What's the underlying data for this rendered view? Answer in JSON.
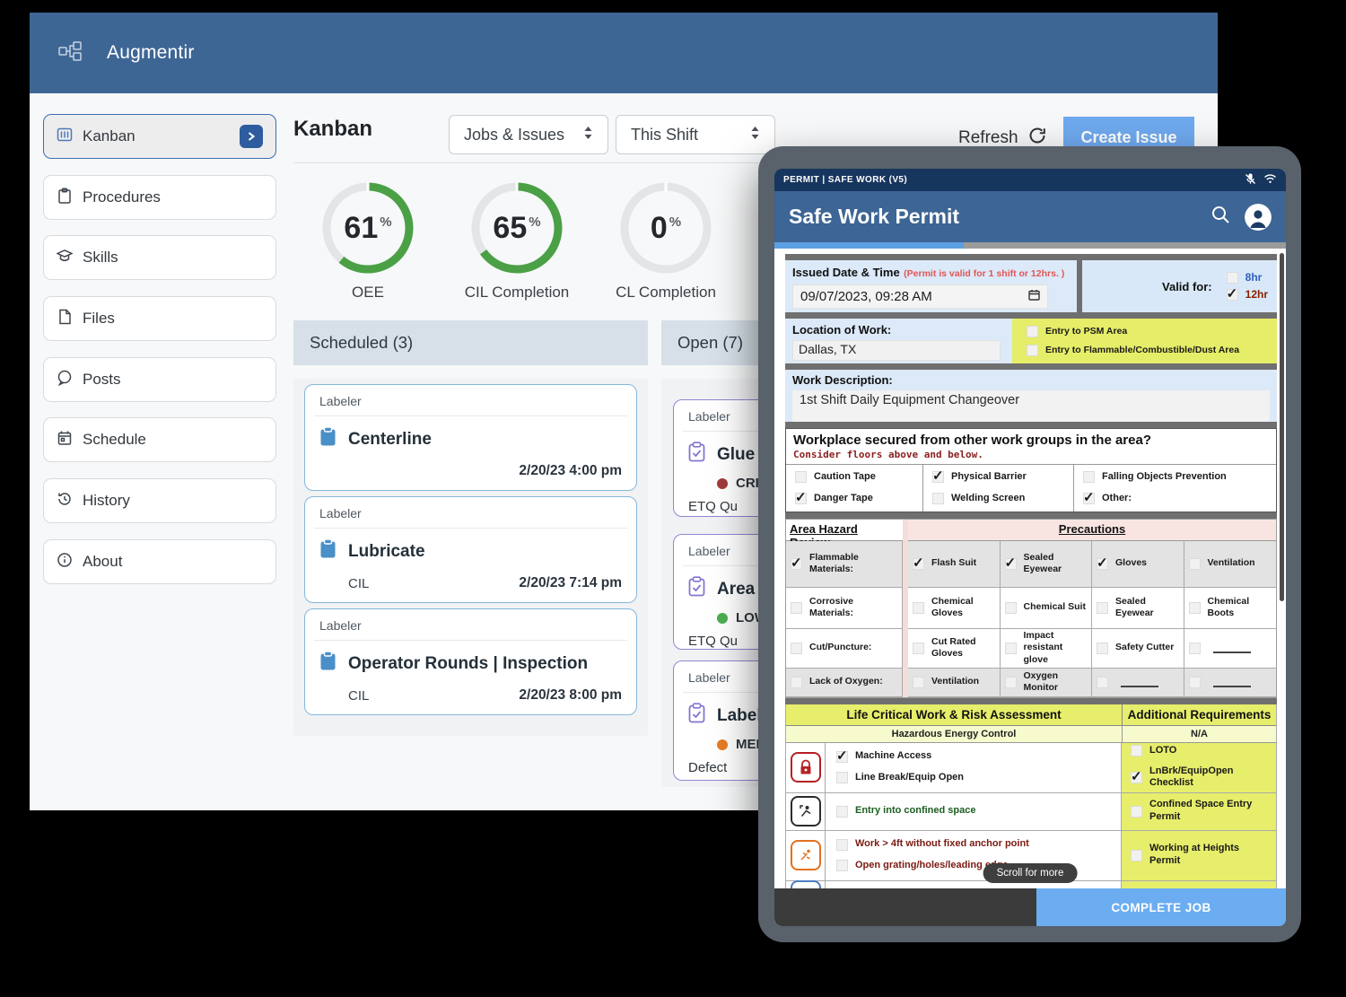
{
  "app": {
    "brand": "Augmentir",
    "title": "Kanban",
    "filters": {
      "scope": "Jobs & Issues",
      "range": "This Shift"
    },
    "actions": {
      "refresh": "Refresh",
      "create_issue": "Create Issue"
    },
    "sidebar": {
      "items": [
        {
          "label": "Kanban",
          "selected": true
        },
        {
          "label": "Procedures"
        },
        {
          "label": "Skills"
        },
        {
          "label": "Files"
        },
        {
          "label": "Posts"
        },
        {
          "label": "Schedule"
        },
        {
          "label": "History"
        },
        {
          "label": "About"
        }
      ]
    },
    "metrics": [
      {
        "value": 61,
        "unit": "%",
        "label": "OEE",
        "color": "#4ba046"
      },
      {
        "value": 65,
        "unit": "%",
        "label": "CIL Completion",
        "color": "#4ba046"
      },
      {
        "value": 0,
        "unit": "%",
        "label": "CL Completion",
        "color": "#4ba046"
      }
    ],
    "board": {
      "columns": [
        {
          "title": "Scheduled (3)",
          "cards": [
            {
              "tag": "Labeler",
              "title": "Centerline",
              "subtitle": "",
              "timestamp": "2/20/23 4:00 pm"
            },
            {
              "tag": "Labeler",
              "title": "Lubricate",
              "subtitle": "CIL",
              "timestamp": "2/20/23 7:14 pm"
            },
            {
              "tag": "Labeler",
              "title": "Operator Rounds | Inspection",
              "subtitle": "CIL",
              "timestamp": "2/20/23 8:00 pm"
            }
          ]
        },
        {
          "title": "Open (7)",
          "cards": [
            {
              "tag": "Labeler",
              "title": "Glue i",
              "severity": "CRITI",
              "severity_color": "#a23b3b",
              "source": "ETQ Qu"
            },
            {
              "tag": "Labeler",
              "title": "Area a",
              "severity": "LOW",
              "severity_color": "#4caf50",
              "source": "ETQ Qu"
            },
            {
              "tag": "Labeler",
              "title": "Labele",
              "severity": "MEDI",
              "severity_color": "#e87b24",
              "source": "Defect"
            }
          ]
        }
      ]
    }
  },
  "tablet": {
    "status_bar": {
      "title": "PERMIT | SAFE WORK (V5)"
    },
    "header": {
      "title": "Safe Work Permit"
    },
    "permit": {
      "issued": {
        "label": "Issued Date & Time",
        "note": "(Permit is valid for 1 shift or 12hrs. )",
        "value": "09/07/2023, 09:28 AM"
      },
      "valid_for": {
        "label": "Valid for:",
        "options": [
          {
            "label": "8hr",
            "checked": false,
            "color": "#2e5fc0"
          },
          {
            "label": "12hr",
            "checked": true,
            "color": "#8b2000"
          }
        ]
      },
      "location": {
        "label": "Location of Work:",
        "value": "Dallas, TX"
      },
      "entry_flags": [
        {
          "label": "Entry to PSM Area",
          "checked": false
        },
        {
          "label": "Entry to Flammable/Combustible/Dust Area",
          "checked": false
        }
      ],
      "work_description": {
        "label": "Work Description:",
        "value": "1st Shift Daily Equipment Changeover"
      },
      "secured": {
        "question": "Workplace secured from other work groups in the area?",
        "note": "Consider floors above and below.",
        "options": [
          {
            "label": "Caution Tape",
            "checked": false
          },
          {
            "label": "Danger Tape",
            "checked": true
          },
          {
            "label": "Physical Barrier",
            "checked": true
          },
          {
            "label": "Welding Screen",
            "checked": false
          },
          {
            "label": "Falling Objects Prevention",
            "checked": false
          },
          {
            "label": "Other:",
            "checked": true
          }
        ]
      },
      "hazards": {
        "left_header": "Area Hazard Review",
        "right_header": "Precautions",
        "rows": [
          {
            "hazard": {
              "label": "Flammable Materials:",
              "checked": true
            },
            "precautions": [
              {
                "label": "Flash Suit",
                "checked": true
              },
              {
                "label": "Sealed Eyewear",
                "checked": true
              },
              {
                "label": "Gloves",
                "checked": true
              },
              {
                "label": "Ventilation",
                "checked": false
              }
            ]
          },
          {
            "hazard": {
              "label": "Corrosive Materials:",
              "checked": false
            },
            "precautions": [
              {
                "label": "Chemical Gloves",
                "checked": false
              },
              {
                "label": "Chemical Suit",
                "checked": false
              },
              {
                "label": "Sealed Eyewear",
                "checked": false
              },
              {
                "label": "Chemical Boots",
                "checked": false
              }
            ]
          },
          {
            "hazard": {
              "label": "Cut/Puncture:",
              "checked": false
            },
            "precautions": [
              {
                "label": "Cut Rated Gloves",
                "checked": false
              },
              {
                "label": "Impact resistant glove",
                "checked": false
              },
              {
                "label": "Safety Cutter",
                "checked": false
              },
              {
                "label": "",
                "checked": false,
                "blank": true
              }
            ]
          },
          {
            "hazard": {
              "label": "Lack of Oxygen:",
              "checked": false
            },
            "precautions": [
              {
                "label": "Ventilation",
                "checked": false
              },
              {
                "label": "Oxygen Monitor",
                "checked": false
              },
              {
                "label": "",
                "checked": false,
                "blank": true
              },
              {
                "label": "",
                "checked": false,
                "blank": true
              }
            ]
          }
        ]
      },
      "life_critical": {
        "left_header": "Life Critical Work & Risk Assessment",
        "right_header": "Additional Requirements",
        "sub_left": "Hazardous Energy Control",
        "sub_right": "N/A",
        "rows": [
          {
            "icon": "lockout-icon",
            "items": [
              {
                "label": "Machine Access",
                "checked": true
              },
              {
                "label": "Line Break/Equip Open",
                "checked": false
              }
            ],
            "reqs": [
              {
                "label": "LOTO",
                "checked": false
              },
              {
                "label": "LnBrk/EquipOpen Checklist",
                "checked": true
              }
            ]
          },
          {
            "icon": "confined-space-icon",
            "items": [
              {
                "label": "Entry into confined space",
                "checked": false
              }
            ],
            "reqs": [
              {
                "label": "Confined Space Entry Permit",
                "checked": false
              }
            ]
          },
          {
            "icon": "fall-hazard-icon",
            "items": [
              {
                "label": "Work > 4ft without fixed anchor point",
                "checked": false
              },
              {
                "label": "Open grating/holes/leading edge",
                "checked": false
              }
            ],
            "reqs": [
              {
                "label": "Working at Heights Permit",
                "checked": false
              }
            ]
          }
        ]
      },
      "scroll_hint": "Scroll for more"
    },
    "footer": {
      "complete": "COMPLETE JOB"
    }
  }
}
